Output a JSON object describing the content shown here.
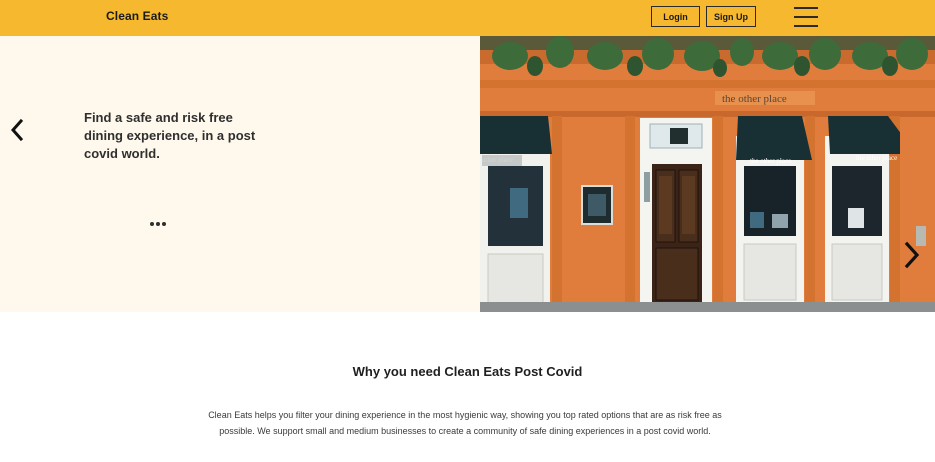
{
  "header": {
    "brand": "Clean Eats",
    "login_label": "Login",
    "signup_label": "Sign Up",
    "menu_icon": "hamburger-menu-icon",
    "background_color": "#f5b82e"
  },
  "hero": {
    "tagline": "Find a safe and risk free dining experience, in a post covid world.",
    "background_color": "#fef9ec",
    "storefront_sign": "the other place",
    "awning_label_left": "other place",
    "awning_label_middle": "the other place",
    "awning_label_right": "the other place",
    "prev_icon": "chevron-left-icon",
    "next_icon": "chevron-right-icon",
    "carousel_indicator": "ellipsis-icon"
  },
  "why_section": {
    "title": "Why you need Clean Eats Post Covid",
    "body": "Clean Eats helps you filter your dining experience in the most hygienic way, showing you top rated options that are as risk free as possible. We support small and medium businesses to create a community of safe dining experiences in a post covid world."
  }
}
